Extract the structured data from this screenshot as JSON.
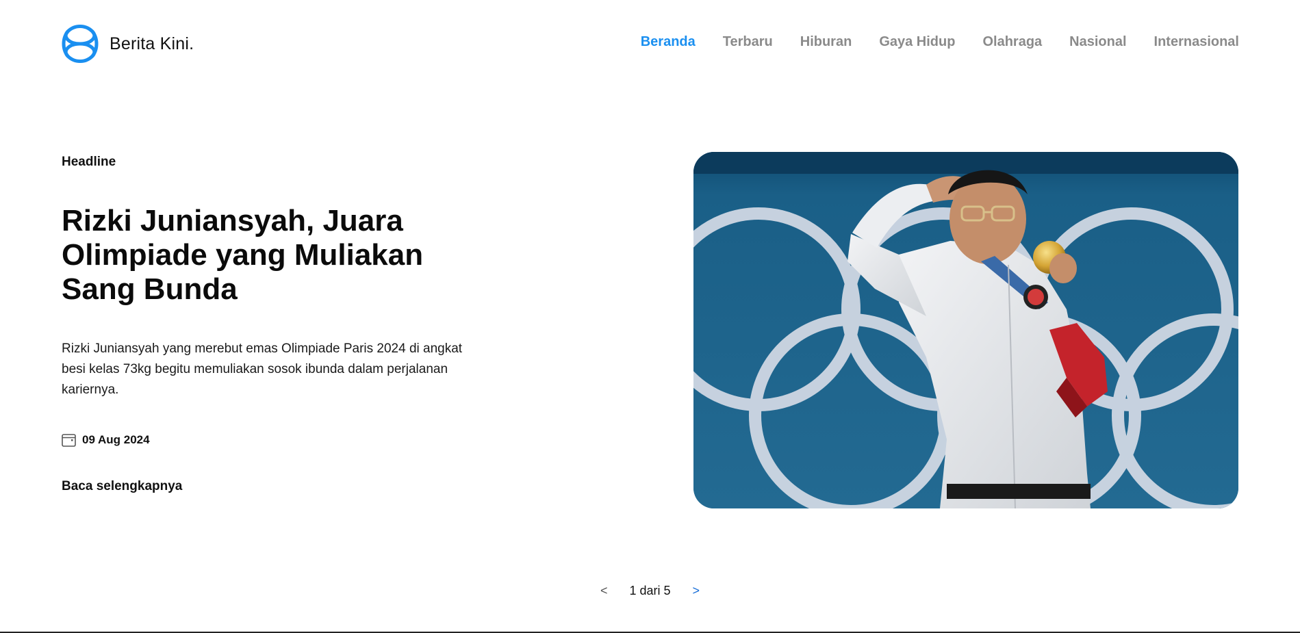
{
  "site": {
    "name": "Berita Kini.",
    "logo_icon": "interlocking-loops-logo",
    "accent_color": "#1a8ff0"
  },
  "nav": {
    "items": [
      {
        "label": "Beranda",
        "active": true
      },
      {
        "label": "Terbaru",
        "active": false
      },
      {
        "label": "Hiburan",
        "active": false
      },
      {
        "label": "Gaya Hidup",
        "active": false
      },
      {
        "label": "Olahraga",
        "active": false
      },
      {
        "label": "Nasional",
        "active": false
      },
      {
        "label": "Internasional",
        "active": false
      }
    ]
  },
  "hero": {
    "kicker": "Headline",
    "title": "Rizki Juniansyah, Juara Olimpiade yang Muliakan Sang Bunda",
    "summary": "Rizki Juniansyah yang merebut emas Olimpiade Paris 2024 di angkat besi kelas 73kg begitu memuliakan sosok ibunda dalam perjalanan kariernya.",
    "date_icon": "calendar-icon",
    "date": "09 Aug 2024",
    "read_more": "Baca selengkapnya",
    "image_subject": "athlete-saluting-with-gold-medal"
  },
  "pagination": {
    "prev": "<",
    "status": "1 dari 5",
    "next": ">"
  }
}
